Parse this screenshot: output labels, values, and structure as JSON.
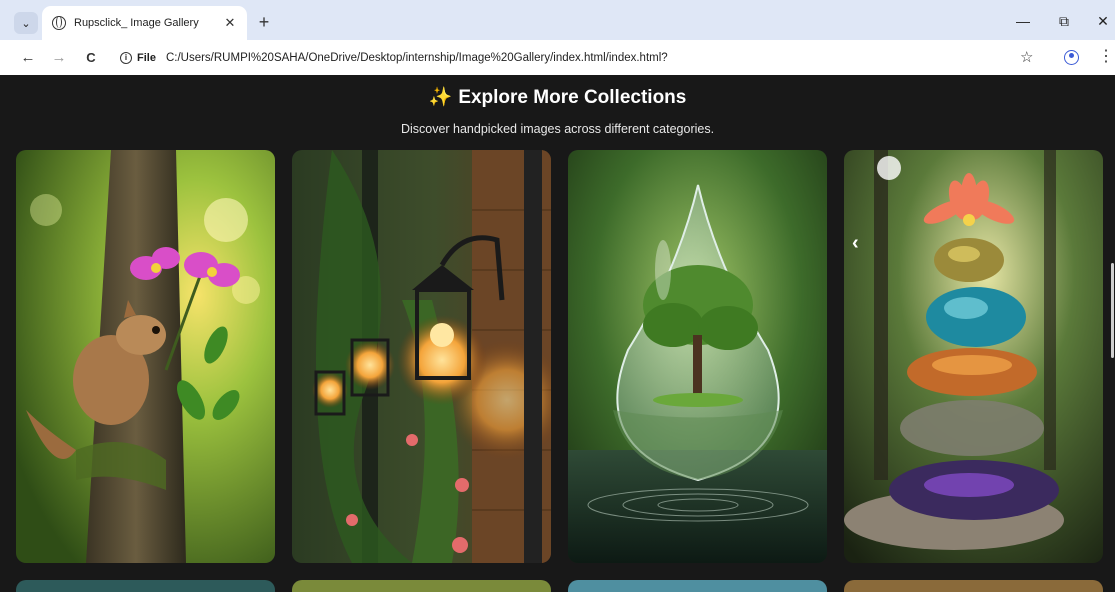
{
  "browser": {
    "tab_title": "Rupsclick_ Image Gallery",
    "site_chip": "File",
    "url": "C:/Users/RUMPI%20SAHA/OneDrive/Desktop/internship/Image%20Gallery/index.html/index.html?"
  },
  "page": {
    "title": "Explore More Collections",
    "subtitle": "Discover handpicked images across different categories."
  },
  "gallery": {
    "cards": [
      {
        "subject": "squirrel with pink orchid on tree trunk"
      },
      {
        "subject": "wall lanterns with ivy and roses"
      },
      {
        "subject": "water drop containing a tree"
      },
      {
        "subject": "stacked glass stones with lotus flower"
      }
    ]
  },
  "icons": {
    "sparkle": "✨",
    "back": "←",
    "forward": "→",
    "reload": "C",
    "star": "☆",
    "prev": "‹"
  },
  "colors": {
    "page_bg": "#181818",
    "tabstrip_bg": "#dfe7f6",
    "accent": "#3b5bd6"
  }
}
